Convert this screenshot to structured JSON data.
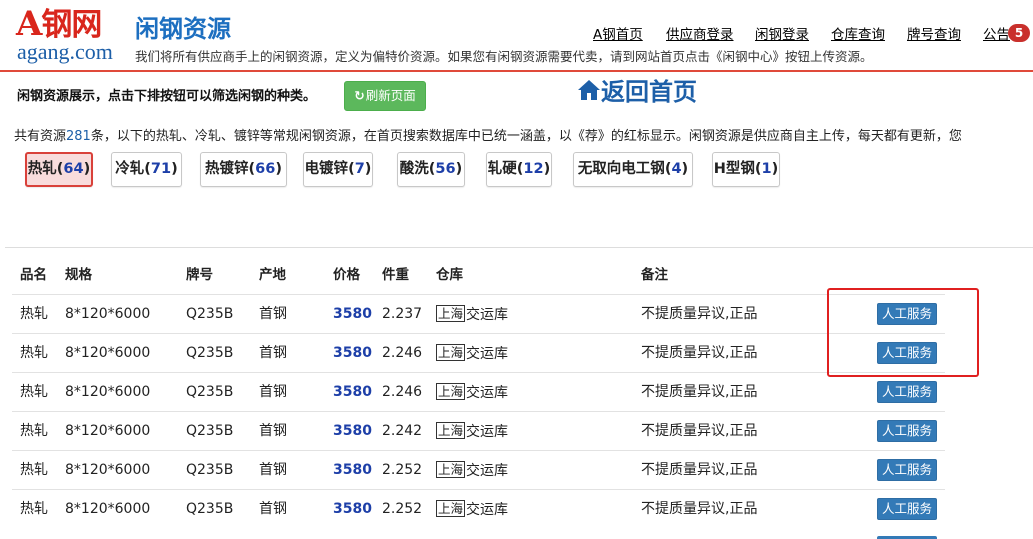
{
  "logo": {
    "cn_a": "A",
    "cn_rest": "钢网",
    "en": "agang.com"
  },
  "header": {
    "title": "闲钢资源",
    "description": "我们将所有供应商手上的闲钢资源，定义为偏特价资源。如果您有闲钢资源需要代卖，请到网站首页点击《闲钢中心》按钮上传资源。",
    "nav": [
      "A钢首页",
      "供应商登录",
      "闲钢登录",
      "仓库查询",
      "牌号查询",
      "公告"
    ],
    "notice_count": "5"
  },
  "intro": {
    "text": "闲钢资源展示，点击下排按钮可以筛选闲钢的种类。",
    "refresh_label": "刷新页面",
    "home_label": "返回首页"
  },
  "summary": {
    "prefix": "共有资源",
    "count": "281",
    "suffix": "条，以下的热轧、冷轧、镀锌等常规闲钢资源，在首页搜索数据库中已统一涵盖，以《荐》的红标显示。闲钢资源是供应商自主上传，每天都有更新，您"
  },
  "filters": [
    {
      "name": "热轧",
      "count": "64",
      "active": true
    },
    {
      "name": "冷轧",
      "count": "71"
    },
    {
      "name": "热镀锌",
      "count": "66"
    },
    {
      "name": "电镀锌",
      "count": "7"
    },
    {
      "name": "酸洗",
      "count": "56"
    },
    {
      "name": "轧硬",
      "count": "12"
    },
    {
      "name": "无取向电工钢",
      "count": "4"
    },
    {
      "name": "H型钢",
      "count": "1"
    }
  ],
  "table": {
    "headers": [
      "品名",
      "规格",
      "牌号",
      "产地",
      "价格",
      "件重",
      "仓库",
      "备注"
    ],
    "service_label": "人工服务",
    "rows": [
      {
        "product": "热轧",
        "spec": "8*120*6000",
        "grade": "Q235B",
        "origin": "首钢",
        "price": "3580",
        "weight": "2.237",
        "wh_city": "上海",
        "wh_name": "交运库",
        "note": "不提质量异议,正品"
      },
      {
        "product": "热轧",
        "spec": "8*120*6000",
        "grade": "Q235B",
        "origin": "首钢",
        "price": "3580",
        "weight": "2.246",
        "wh_city": "上海",
        "wh_name": "交运库",
        "note": "不提质量异议,正品"
      },
      {
        "product": "热轧",
        "spec": "8*120*6000",
        "grade": "Q235B",
        "origin": "首钢",
        "price": "3580",
        "weight": "2.246",
        "wh_city": "上海",
        "wh_name": "交运库",
        "note": "不提质量异议,正品"
      },
      {
        "product": "热轧",
        "spec": "8*120*6000",
        "grade": "Q235B",
        "origin": "首钢",
        "price": "3580",
        "weight": "2.242",
        "wh_city": "上海",
        "wh_name": "交运库",
        "note": "不提质量异议,正品"
      },
      {
        "product": "热轧",
        "spec": "8*120*6000",
        "grade": "Q235B",
        "origin": "首钢",
        "price": "3580",
        "weight": "2.252",
        "wh_city": "上海",
        "wh_name": "交运库",
        "note": "不提质量异议,正品"
      },
      {
        "product": "热轧",
        "spec": "8*120*6000",
        "grade": "Q235B",
        "origin": "首钢",
        "price": "3580",
        "weight": "2.252",
        "wh_city": "上海",
        "wh_name": "交运库",
        "note": "不提质量异议,正品"
      }
    ]
  },
  "colors": {
    "brand_red": "#d9261c",
    "brand_blue": "#1d6fc0",
    "refresh_green": "#5cb85c",
    "service_blue": "#337ab7",
    "highlight_red": "#e02020"
  }
}
